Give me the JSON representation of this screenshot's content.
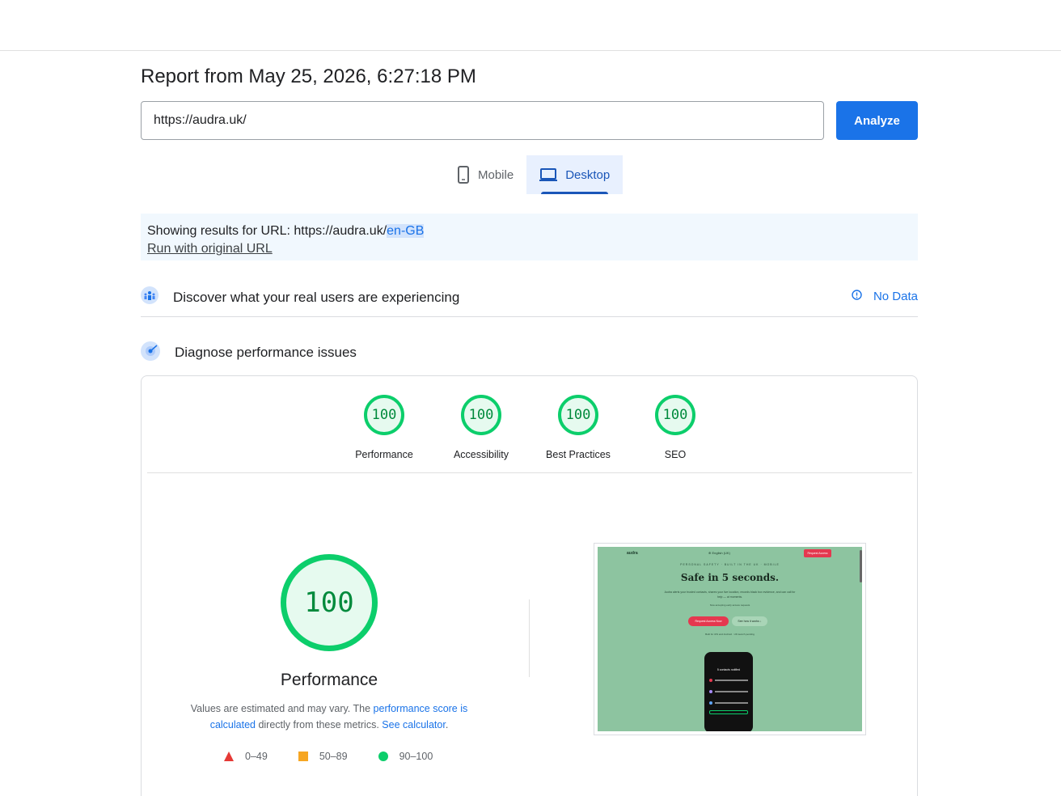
{
  "report": {
    "title": "Report from May 25, 2026, 6:27:18 PM",
    "url_value": "https://audra.uk/",
    "analyze_label": "Analyze"
  },
  "tabs": [
    {
      "label": "Mobile",
      "icon": "smartphone-icon",
      "active": false
    },
    {
      "label": "Desktop",
      "icon": "laptop-icon",
      "active": true
    }
  ],
  "notice": {
    "prefix": "Showing results for URL: https://audra.uk/",
    "highlight": "en-GB",
    "run_link": "Run with original URL"
  },
  "real_users": {
    "label": "Discover what your real users are experiencing",
    "status": "No Data",
    "icon": "users-icon"
  },
  "diagnose": {
    "label": "Diagnose performance issues",
    "icon": "lighthouse-icon"
  },
  "scores": [
    {
      "label": "Performance",
      "value": "100"
    },
    {
      "label": "Accessibility",
      "value": "100"
    },
    {
      "label": "Best Practices",
      "value": "100"
    },
    {
      "label": "SEO",
      "value": "100"
    }
  ],
  "main_score": {
    "value": "100",
    "label": "Performance",
    "desc_1": "Values are estimated and may vary. The ",
    "desc_link1": "performance score is calculated",
    "desc_2": " directly from these metrics. ",
    "desc_link2": "See calculator",
    "desc_3": "."
  },
  "legend": [
    {
      "range": "0–49",
      "color": "#e53935",
      "shape": "triangle"
    },
    {
      "range": "50–89",
      "color": "#f6a623",
      "shape": "square"
    },
    {
      "range": "90–100",
      "color": "#0cce6b",
      "shape": "circle"
    }
  ],
  "screenshot": {
    "logo": "audra",
    "nav": "⊕ English (UK)",
    "cta_top": "Request Access",
    "kicker": "PERSONAL SAFETY · BUILT IN THE UK · MOBILE",
    "headline": "Safe in 5 seconds.",
    "sub": "Audra alerts your trusted contacts, shares your live location, records black box evidence, and can call for help — at moments.",
    "sub2": "Now accepting early access requests",
    "btn1": "Request Access Now",
    "btn2": "See how it works ↓",
    "fine": "Built for iOS and Android · UK launch pending",
    "phone_title": "5 contacts notified"
  }
}
